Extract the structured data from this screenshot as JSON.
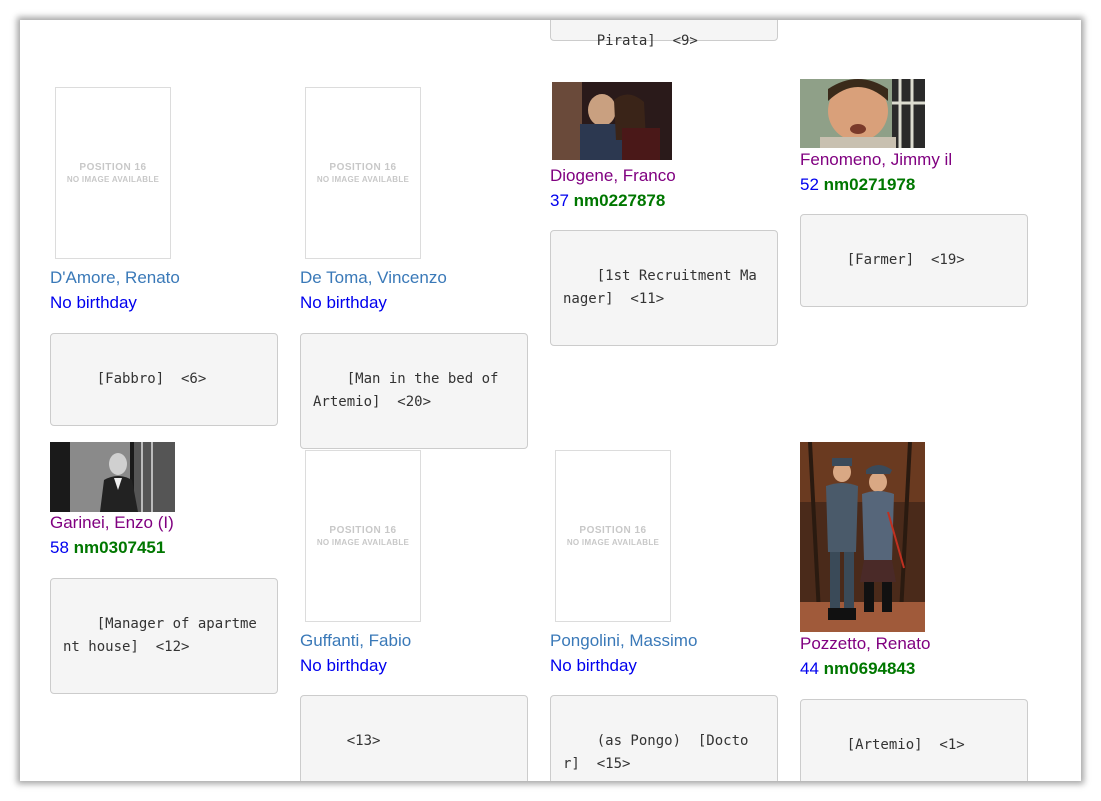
{
  "top_partial": {
    "text": "Pirata]  <9>"
  },
  "placeholder": {
    "line1": "POSITION 16",
    "line2": "NO IMAGE AVAILABLE"
  },
  "cast": [
    {
      "name": "D'Amore, Renato",
      "birthday": "No birthday",
      "role": "[Fabbro]  <6>",
      "photo": "placeholder"
    },
    {
      "name": "De Toma, Vincenzo",
      "birthday": "No birthday",
      "role": "[Man in the bed of Artemio]  <20>",
      "photo": "placeholder"
    },
    {
      "name": "Diogene, Franco",
      "age": "37",
      "nmid": "nm0227878",
      "role": "[1st Recruitment Manager]  <11>",
      "photo": "photo"
    },
    {
      "name": "Fenomeno, Jimmy il",
      "age": "52",
      "nmid": "nm0271978",
      "role": "[Farmer]  <19>",
      "photo": "photo"
    },
    {
      "name": "Garinei, Enzo (I)",
      "age": "58",
      "nmid": "nm0307451",
      "role": "[Manager of apartment house]  <12>",
      "photo": "photo"
    },
    {
      "name": "Guffanti, Fabio",
      "birthday": "No birthday",
      "role": "<13>",
      "photo": "placeholder"
    },
    {
      "name": "Pongolini, Massimo",
      "birthday": "No birthday",
      "role": "(as Pongo)  [Doctor]  <15>",
      "photo": "placeholder"
    },
    {
      "name": "Pozzetto, Renato",
      "age": "44",
      "nmid": "nm0694843",
      "role": "[Artemio]  <1>",
      "photo": "photo"
    }
  ],
  "colors": {
    "link_blue": "#3a79b8",
    "visited_purple": "#800080",
    "age_blue": "#0000ee",
    "nm_green": "#007700"
  }
}
